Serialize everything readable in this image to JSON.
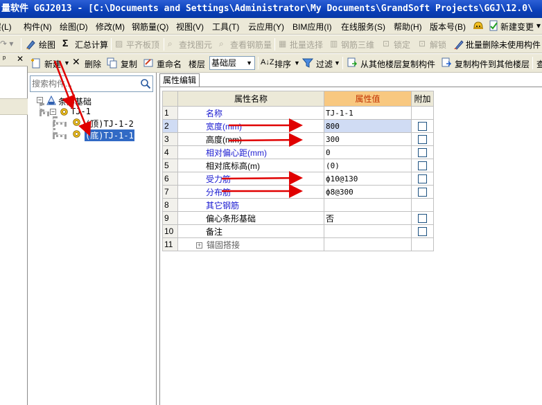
{
  "window": {
    "title": "量软件 GGJ2013 - [C:\\Documents and Settings\\Administrator\\My Documents\\GrandSoft Projects\\GGJ\\12.0\\"
  },
  "menu": {
    "items": [
      {
        "label": "层(L)"
      },
      {
        "label": "构件(N)"
      },
      {
        "label": "绘图(D)"
      },
      {
        "label": "修改(M)"
      },
      {
        "label": "钢筋量(Q)"
      },
      {
        "label": "视图(V)"
      },
      {
        "label": "工具(T)"
      },
      {
        "label": "云应用(Y)"
      },
      {
        "label": "BIM应用(I)"
      },
      {
        "label": "在线服务(S)"
      },
      {
        "label": "帮助(H)"
      },
      {
        "label": "版本号(B)"
      }
    ],
    "new_change_label": "新建变更"
  },
  "toolbar": {
    "draw": "绘图",
    "sum_symbol": "Σ",
    "summary_calc": "汇总计算",
    "flush_slab": "平齐板顶",
    "find_element": "查找图元",
    "view_rebar": "查看钢筋量",
    "batch_select": "批量选择",
    "rebar_3d": "钢筋三维",
    "lock": "锁定",
    "unlock": "解锁",
    "batch_delete_unused": "批量删除未使用构件"
  },
  "component_toolbar": {
    "new": "新建",
    "delete": "删除",
    "copy": "复制",
    "rename": "重命名",
    "floor_label": "楼层",
    "floor_value": "基础层",
    "sort": "排序",
    "filter": "过滤",
    "copy_from_other_floor": "从其他楼层复制构件",
    "copy_to_other_floor": "复制构件到其他楼层",
    "overflow_label": "查"
  },
  "tree": {
    "search_placeholder": "搜索构件...",
    "root": "条形基础",
    "group": "TJ-1",
    "children": [
      {
        "label": "(顶)TJ-1-2",
        "selected": false
      },
      {
        "label": "(底)TJ-1-1",
        "selected": true
      }
    ]
  },
  "properties": {
    "tab_label": "属性编辑",
    "columns": {
      "name": "属性名称",
      "value": "属性值",
      "add": "附加"
    },
    "rows": [
      {
        "num": "1",
        "name": "名称",
        "value": "TJ-1-1",
        "blue": true,
        "check": false
      },
      {
        "num": "2",
        "name": "宽度(mm)",
        "value": "800",
        "blue": true,
        "check": true
      },
      {
        "num": "3",
        "name": "高度(mm)",
        "value": "300",
        "blue": false,
        "check": true
      },
      {
        "num": "4",
        "name": "相对偏心距(mm)",
        "value": "0",
        "blue": true,
        "check": true
      },
      {
        "num": "5",
        "name": "相对底标高(m)",
        "value": "(0)",
        "blue": false,
        "check": true
      },
      {
        "num": "6",
        "name": "受力筋",
        "value": "ф10@130",
        "blue": true,
        "check": true
      },
      {
        "num": "7",
        "name": "分布筋",
        "value": "ф8@300",
        "blue": true,
        "check": true
      },
      {
        "num": "8",
        "name": "其它钢筋",
        "value": "",
        "blue": true,
        "check": false
      },
      {
        "num": "9",
        "name": "偏心条形基础",
        "value": "否",
        "blue": false,
        "check": true
      },
      {
        "num": "10",
        "name": "备注",
        "value": "",
        "blue": false,
        "check": true
      },
      {
        "num": "11",
        "name": "锚固搭接",
        "value": "",
        "blue": false,
        "check": false,
        "expand": "+"
      }
    ]
  },
  "colors": {
    "titlebar": "#0a3fb8",
    "selection": "#316ac5",
    "header_highlight": "#f8c880",
    "annotation_arrow": "#e00000"
  }
}
